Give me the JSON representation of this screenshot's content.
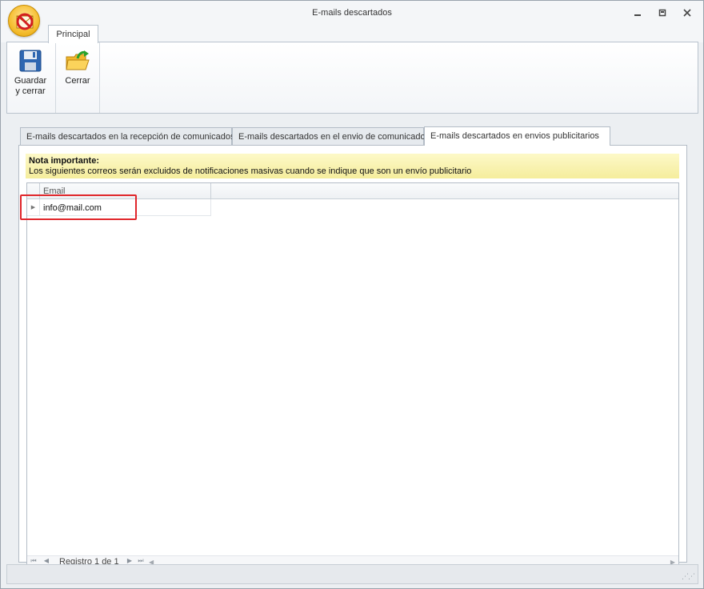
{
  "window": {
    "title": "E-mails descartados",
    "minimize_icon": "minimize-icon",
    "maximize_icon": "restore-icon",
    "close_icon": "close-icon"
  },
  "ribbon": {
    "tab_label": "Principal",
    "buttons": {
      "save_close_label_line1": "Guardar",
      "save_close_label_line2": "y cerrar",
      "save_icon": "floppy-disk-icon",
      "close_label": "Cerrar",
      "close_icon": "folder-arrow-icon"
    }
  },
  "tabs": [
    {
      "label": "E-mails descartados en la recepción de comunicados",
      "active": false
    },
    {
      "label": "E-mails descartados en el envio de comunicado",
      "active": false
    },
    {
      "label": "E-mails descartados en envios publicitarios",
      "active": true
    }
  ],
  "note": {
    "title": "Nota importante:",
    "text": "Los siguientes correos serán excluidos de notificaciones masivas cuando se indique que son un envío publicitario"
  },
  "grid": {
    "columns": [
      "Email"
    ],
    "rows": [
      {
        "email": "info@mail.com"
      }
    ],
    "footer": {
      "record_text": "Registro 1 de 1"
    }
  },
  "colors": {
    "highlight": "#e0262b",
    "note_background": "#f5ed9c",
    "app_button": "#f7c23a"
  }
}
